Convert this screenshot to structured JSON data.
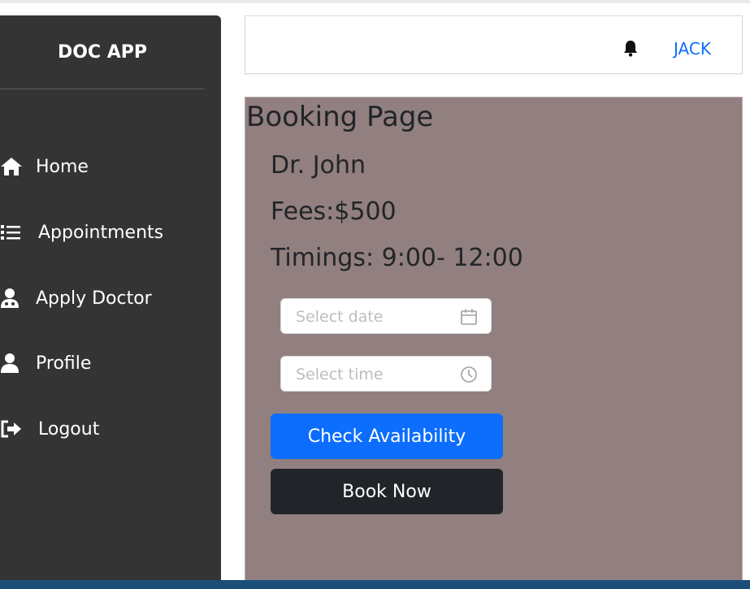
{
  "app": {
    "logo": "DOC APP"
  },
  "sidebar": {
    "items": [
      {
        "label": "Home",
        "icon": "home-icon"
      },
      {
        "label": "Appointments",
        "icon": "list-icon"
      },
      {
        "label": "Apply Doctor",
        "icon": "doctor-icon"
      },
      {
        "label": "Profile",
        "icon": "user-icon"
      },
      {
        "label": "Logout",
        "icon": "logout-icon"
      }
    ]
  },
  "header": {
    "notification_icon": "bell-icon",
    "user_name": "JACK"
  },
  "booking": {
    "title": "Booking Page",
    "doctor_name": "Dr. John",
    "fees": "Fees:$500",
    "timings": "Timings: 9:00- 12:00",
    "date_placeholder": "Select date",
    "time_placeholder": "Select time",
    "check_button": "Check Availability",
    "book_button": "Book Now"
  },
  "colors": {
    "sidebar_bg": "#343434",
    "content_bg": "#927f7f",
    "primary": "#0d6efd",
    "dark": "#212529",
    "link": "#0d6efd"
  }
}
